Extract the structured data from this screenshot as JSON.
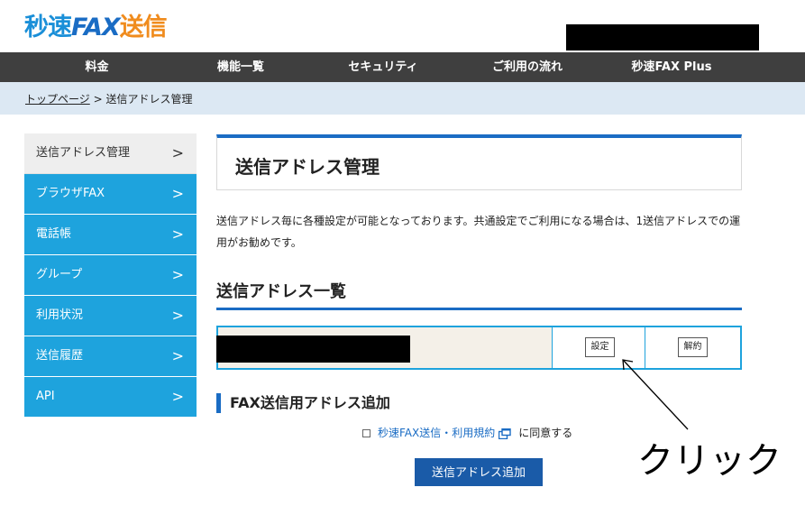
{
  "header": {
    "logo": {
      "part1": "秒速",
      "part2": "FAX",
      "part3": "送信"
    }
  },
  "nav": {
    "items": [
      "料金",
      "機能一覧",
      "セキュリティ",
      "ご利用の流れ",
      "秒速FAX Plus"
    ]
  },
  "breadcrumb": {
    "home": "トップページ",
    "separator": " > ",
    "current": "送信アドレス管理"
  },
  "sidebar": {
    "items": [
      {
        "label": "送信アドレス管理",
        "active": true
      },
      {
        "label": "ブラウザFAX",
        "active": false
      },
      {
        "label": "電話帳",
        "active": false
      },
      {
        "label": "グループ",
        "active": false
      },
      {
        "label": "利用状況",
        "active": false
      },
      {
        "label": "送信履歴",
        "active": false
      },
      {
        "label": "API",
        "active": false
      }
    ],
    "chevron": ">"
  },
  "main": {
    "title": "送信アドレス管理",
    "description": "送信アドレス毎に各種設定が可能となっております。共通設定でご利用になる場合は、1送信アドレスでの運用がお勧めです。",
    "list_heading": "送信アドレス一覧",
    "settings_button": "設定",
    "cancel_button": "解約",
    "add_heading": "FAX送信用アドレス追加",
    "terms_link": "秒速FAX送信・利用規約",
    "agree_suffix": "に同意する",
    "submit_button": "送信アドレス追加"
  },
  "annotation": {
    "text": "クリック"
  },
  "colors": {
    "brand_blue": "#1a6cc4",
    "sidebar_blue": "#1ea3dd",
    "brand_orange": "#f08c1e",
    "nav_bg": "#3f3f3f"
  }
}
